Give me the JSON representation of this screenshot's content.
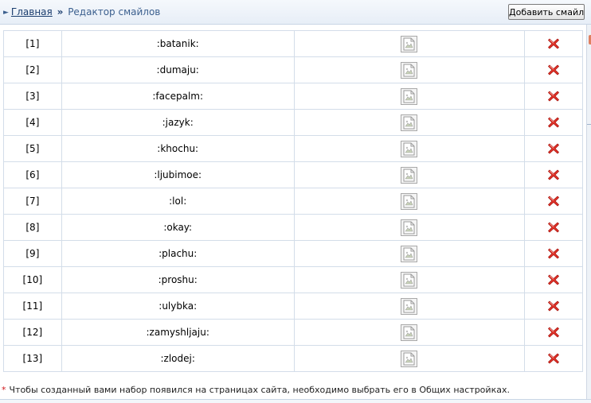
{
  "breadcrumb": {
    "home": "Главная",
    "separator": "»",
    "current": "Редактор смайлов"
  },
  "toolbar": {
    "add_label": "Добавить смайл"
  },
  "table": {
    "rows": [
      {
        "num": "[1]",
        "code": ":batanik:"
      },
      {
        "num": "[2]",
        "code": ":dumaju:"
      },
      {
        "num": "[3]",
        "code": ":facepalm:"
      },
      {
        "num": "[4]",
        "code": ":jazyk:"
      },
      {
        "num": "[5]",
        "code": ":khochu:"
      },
      {
        "num": "[6]",
        "code": ":ljubimoe:"
      },
      {
        "num": "[7]",
        "code": ":lol:"
      },
      {
        "num": "[8]",
        "code": ":okay:"
      },
      {
        "num": "[9]",
        "code": ":plachu:"
      },
      {
        "num": "[10]",
        "code": ":proshu:"
      },
      {
        "num": "[11]",
        "code": ":ulybka:"
      },
      {
        "num": "[12]",
        "code": ":zamyshljaju:"
      },
      {
        "num": "[13]",
        "code": ":zlodej:"
      }
    ],
    "image_icon": "broken-image-icon",
    "delete_icon": "red-x-delete-icon"
  },
  "footnote": {
    "marker": "*",
    "text": "Чтобы созданный вами набор появился на страницах сайта, необходимо выбрать его в Общих настройках."
  },
  "colors": {
    "accent_blue": "#3b5f8e",
    "delete_red": "#d0161a",
    "border": "#d3dde9"
  }
}
